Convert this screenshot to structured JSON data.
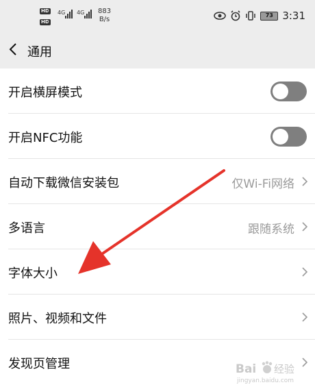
{
  "status_bar": {
    "sim1_badge": "HD",
    "sim2_badge": "HD",
    "net1": "4G",
    "net2": "4G",
    "speed_value": "883",
    "speed_unit": "B/s",
    "battery": "73",
    "time": "3:31"
  },
  "header": {
    "title": "通用"
  },
  "settings": {
    "items": [
      {
        "label": "开启横屏模式",
        "control": "toggle",
        "on": false
      },
      {
        "label": "开启NFC功能",
        "control": "toggle",
        "on": false
      },
      {
        "label": "自动下载微信安装包",
        "value": "仅Wi-Fi网络",
        "control": "chevron"
      },
      {
        "label": "多语言",
        "value": "跟随系统",
        "control": "chevron"
      },
      {
        "label": "字体大小",
        "value": "",
        "control": "chevron"
      },
      {
        "label": "照片、视频和文件",
        "value": "",
        "control": "chevron"
      },
      {
        "label": "发现页管理",
        "value": "",
        "control": "chevron"
      }
    ]
  },
  "annotation": {
    "color": "#e5332a"
  },
  "watermark": {
    "brand": "Bai",
    "brand_cn": "经验",
    "url": "jingyan.baidu.com"
  },
  "colors": {
    "header_bg": "#ededed",
    "toggle_off": "#7f7f7f",
    "secondary_text": "#9a9a9a"
  }
}
